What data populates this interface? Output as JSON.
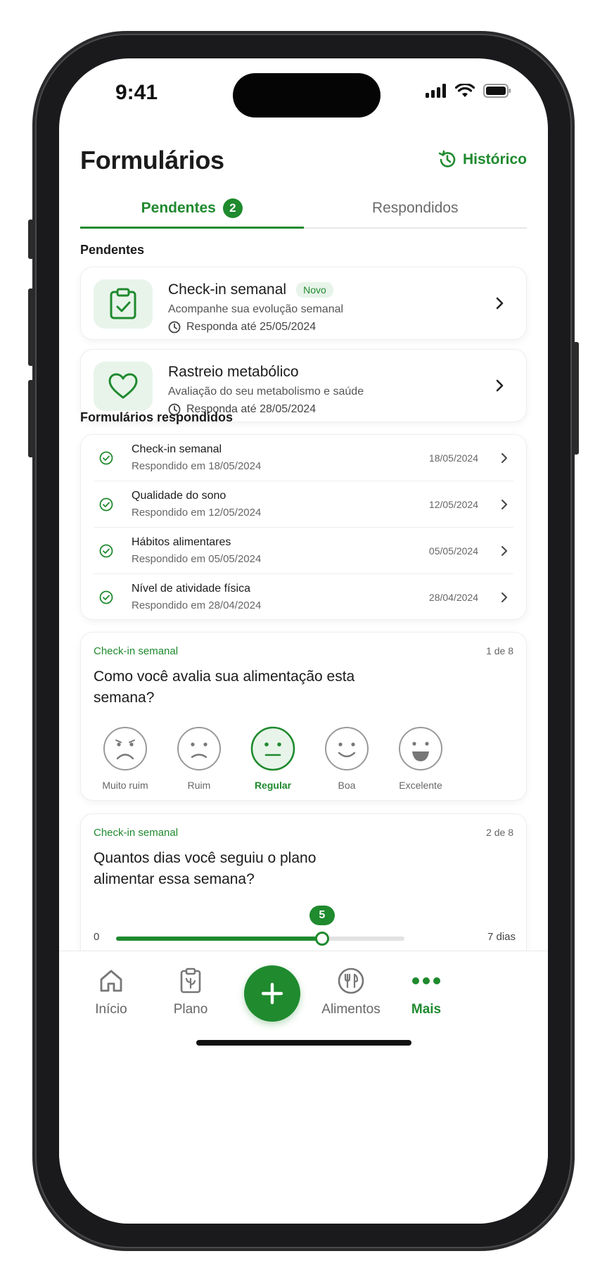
{
  "status": {
    "time": "9:41"
  },
  "header": {
    "title": "Formulários",
    "history_label": "Histórico"
  },
  "tabs": [
    {
      "label": "Pendentes",
      "badge": "2",
      "active": true
    },
    {
      "label": "Respondidos",
      "active": false
    }
  ],
  "pending": {
    "section_title": "Pendentes",
    "items": [
      {
        "icon": "clipboard-check-icon",
        "title": "Check-in semanal",
        "badge": "Novo",
        "subtitle": "Acompanhe sua evolução semanal",
        "due": "Responda até 25/05/2024"
      },
      {
        "icon": "heart-icon",
        "title": "Rastreio metabólico",
        "subtitle": "Avaliação do seu metabolismo e saúde",
        "due": "Responda até 28/05/2024"
      }
    ]
  },
  "responded": {
    "section_title": "Formulários respondidos",
    "items": [
      {
        "title": "Check-in semanal",
        "subtitle": "Respondido em 18/05/2024",
        "date": "18/05/2024"
      },
      {
        "title": "Qualidade do sono",
        "subtitle": "Respondido em 12/05/2024",
        "date": "12/05/2024"
      },
      {
        "title": "Hábitos alimentares",
        "subtitle": "Respondido em 05/05/2024",
        "date": "05/05/2024"
      },
      {
        "title": "Nível de atividade física",
        "subtitle": "Respondido em 28/04/2024",
        "date": "28/04/2024"
      }
    ]
  },
  "question1": {
    "tag": "Check-in semanal",
    "count": "1 de 8",
    "text": "Como você avalia sua alimentação esta semana?",
    "options": [
      "Muito ruim",
      "Ruim",
      "Regular",
      "Boa",
      "Excelente"
    ],
    "selected": "Regular"
  },
  "question2": {
    "tag": "Check-in semanal",
    "count": "2 de 8",
    "text": "Quantos dias você seguiu o plano alimentar essa semana?",
    "slider": {
      "min_label": "0",
      "max_label": "7  dias",
      "min": 0,
      "max": 7,
      "value": 5,
      "value_label": "5"
    }
  },
  "bottom_nav": {
    "items": [
      {
        "label": "Início",
        "icon": "home-icon"
      },
      {
        "label": "Plano",
        "icon": "plan-clipboard-icon"
      },
      {
        "label": "Alimentos",
        "icon": "fork-knife-icon"
      },
      {
        "label": "Mais",
        "icon": "more-dots-icon",
        "active": true
      }
    ],
    "fab_icon": "plus-icon"
  },
  "colors": {
    "accent": "#1f8a2e",
    "accent_light": "#e8f4ea",
    "text": "#1b1b1b",
    "muted": "#666666"
  }
}
